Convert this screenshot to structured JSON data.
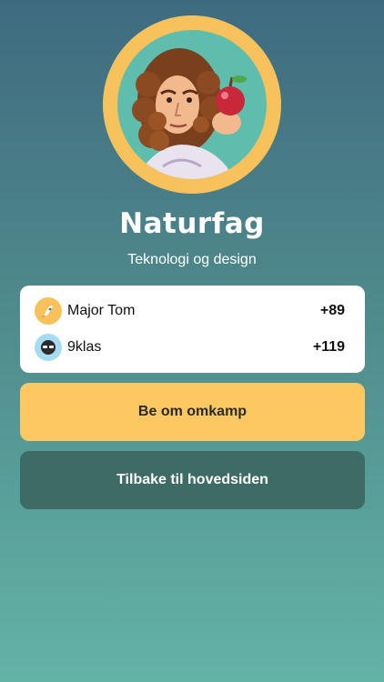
{
  "quiz": {
    "title": "Naturfag",
    "subtitle": "Teknologi og design",
    "illustration": "scientist-with-apple-illustration"
  },
  "results": [
    {
      "name": "Major Tom",
      "score": "+89",
      "avatar_icon": "rocket-icon",
      "avatar_bg": "#f7c25c"
    },
    {
      "name": "9klas",
      "score": "+119",
      "avatar_icon": "sunglasses-icon",
      "avatar_bg": "#a6dcef"
    }
  ],
  "actions": {
    "rematch_label": "Be om omkamp",
    "home_label": "Tilbake til hovedsiden"
  },
  "colors": {
    "accent_yellow": "#fdc862",
    "dark_teal_button": "#3e6b66",
    "bg_top": "#3f6b80",
    "bg_bottom": "#63b3a7"
  }
}
